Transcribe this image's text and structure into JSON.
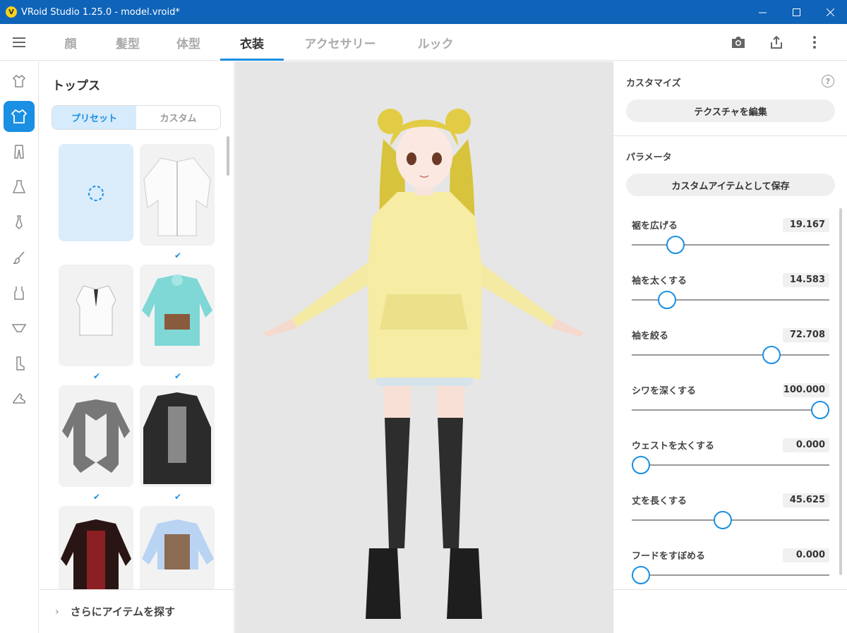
{
  "window": {
    "title": "VRoid Studio 1.25.0 - model.vroid*",
    "controls": [
      "minimize",
      "maximize",
      "close"
    ]
  },
  "nav": {
    "tabs": [
      {
        "label": "顔",
        "active": false
      },
      {
        "label": "髪型",
        "active": false
      },
      {
        "label": "体型",
        "active": false
      },
      {
        "label": "衣装",
        "active": true
      },
      {
        "label": "アクセサリー",
        "active": false
      },
      {
        "label": "ルック",
        "active": false
      }
    ],
    "right_icons": [
      "camera-icon",
      "export-icon",
      "more-vertical-icon"
    ]
  },
  "rail": {
    "items": [
      "shirt-icon",
      "tops-icon",
      "pants-icon",
      "onepiece-icon",
      "tie-icon",
      "brush-icon",
      "tank-top-icon",
      "underwear-icon",
      "sock-icon",
      "shoe-icon"
    ],
    "active_index": 1
  },
  "item_panel": {
    "title": "トップス",
    "segments": [
      {
        "label": "プリセット",
        "active": true
      },
      {
        "label": "カスタム",
        "active": false
      }
    ],
    "items": [
      {
        "name": "none",
        "checked": false,
        "selected": true
      },
      {
        "name": "white-zip-jacket",
        "checked": true
      },
      {
        "name": "white-blouse",
        "checked": true
      },
      {
        "name": "cyan-hoodie",
        "checked": true
      },
      {
        "name": "gray-vest-coat",
        "checked": true
      },
      {
        "name": "black-long-coat",
        "checked": true
      },
      {
        "name": "red-military-coat",
        "checked": false
      },
      {
        "name": "blue-corset-blouse",
        "checked": false
      }
    ],
    "find_more": "さらにアイテムを探す"
  },
  "right_panel": {
    "customize_title": "カスタマイズ",
    "edit_texture": "テクスチャを編集",
    "params_title": "パラメータ",
    "save_custom": "カスタムアイテムとして保存",
    "params": [
      {
        "label": "裾を広げる",
        "value": "19.167",
        "pct": 19.167
      },
      {
        "label": "袖を太くする",
        "value": "14.583",
        "pct": 14.583
      },
      {
        "label": "袖を絞る",
        "value": "72.708",
        "pct": 72.708
      },
      {
        "label": "シワを深くする",
        "value": "100.000",
        "pct": 100
      },
      {
        "label": "ウェストを太くする",
        "value": "0.000",
        "pct": 0
      },
      {
        "label": "丈を長くする",
        "value": "45.625",
        "pct": 45.625
      },
      {
        "label": "フードをすぼめる",
        "value": "0.000",
        "pct": 0
      }
    ]
  },
  "colors": {
    "titlebar": "#0f63b8",
    "accent": "#1a8fe3",
    "viewport_bg": "#e6e6e6"
  }
}
